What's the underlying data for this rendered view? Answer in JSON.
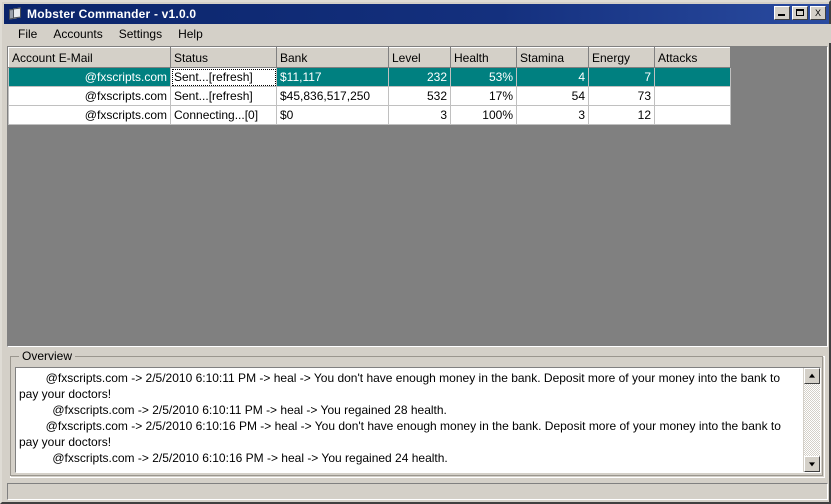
{
  "window": {
    "title": "Mobster Commander - v1.0.0",
    "icon": "app-cards-icon",
    "controls": {
      "minimize": "_",
      "maximize": "□",
      "close": "X"
    }
  },
  "menu": {
    "items": [
      "File",
      "Accounts",
      "Settings",
      "Help"
    ]
  },
  "grid": {
    "columns": [
      "Account E-Mail",
      "Status",
      "Bank",
      "Level",
      "Health",
      "Stamina",
      "Energy",
      "Attacks"
    ],
    "selection_color": "#008080",
    "rows": [
      {
        "selected": true,
        "email": "@fxscripts.com",
        "status": "Sent...[refresh]",
        "bank": "$11,117",
        "level": "232",
        "health": "53%",
        "stamina": "4",
        "energy": "7",
        "attacks": ""
      },
      {
        "selected": false,
        "email": "@fxscripts.com",
        "status": "Sent...[refresh]",
        "bank": "$45,836,517,250",
        "level": "532",
        "health": "17%",
        "stamina": "54",
        "energy": "73",
        "attacks": ""
      },
      {
        "selected": false,
        "email": "@fxscripts.com",
        "status": "Connecting...[0]",
        "bank": "$0",
        "level": "3",
        "health": "100%",
        "stamina": "3",
        "energy": "12",
        "attacks": ""
      }
    ]
  },
  "overview": {
    "legend": "Overview",
    "log": "        @fxscripts.com -> 2/5/2010 6:10:11 PM -> heal -> You don't have enough money in the bank. Deposit more of your money into the bank to pay your doctors!\n          @fxscripts.com -> 2/5/2010 6:10:11 PM -> heal -> You regained 28 health.\n        @fxscripts.com -> 2/5/2010 6:10:16 PM -> heal -> You don't have enough money in the bank. Deposit more of your money into the bank to pay your doctors!\n          @fxscripts.com -> 2/5/2010 6:10:16 PM -> heal -> You regained 24 health.",
    "scrollbar": {
      "up": "scroll-up-arrow",
      "down": "scroll-down-arrow"
    }
  },
  "statusbar": {
    "text": ""
  }
}
